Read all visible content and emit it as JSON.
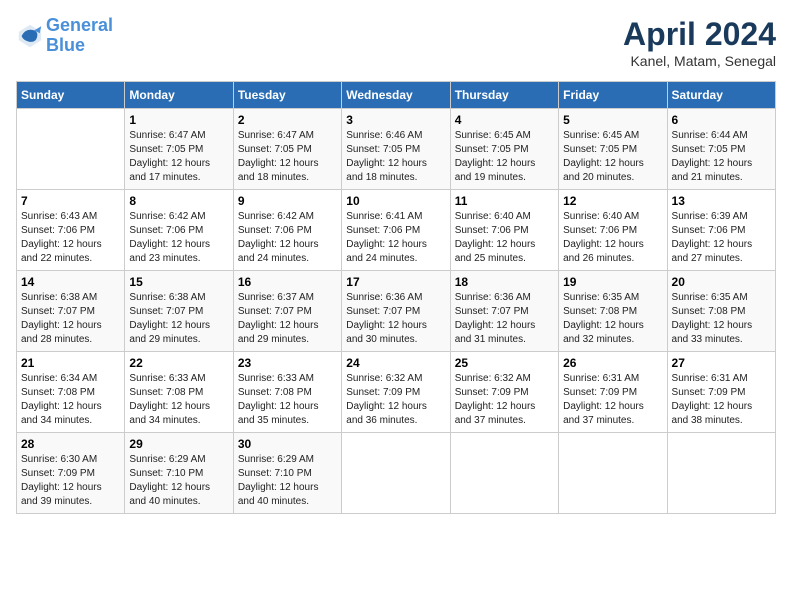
{
  "header": {
    "logo_line1": "General",
    "logo_line2": "Blue",
    "month": "April 2024",
    "location": "Kanel, Matam, Senegal"
  },
  "days_of_week": [
    "Sunday",
    "Monday",
    "Tuesday",
    "Wednesday",
    "Thursday",
    "Friday",
    "Saturday"
  ],
  "weeks": [
    [
      {
        "day": "",
        "info": ""
      },
      {
        "day": "1",
        "info": "Sunrise: 6:47 AM\nSunset: 7:05 PM\nDaylight: 12 hours\nand 17 minutes."
      },
      {
        "day": "2",
        "info": "Sunrise: 6:47 AM\nSunset: 7:05 PM\nDaylight: 12 hours\nand 18 minutes."
      },
      {
        "day": "3",
        "info": "Sunrise: 6:46 AM\nSunset: 7:05 PM\nDaylight: 12 hours\nand 18 minutes."
      },
      {
        "day": "4",
        "info": "Sunrise: 6:45 AM\nSunset: 7:05 PM\nDaylight: 12 hours\nand 19 minutes."
      },
      {
        "day": "5",
        "info": "Sunrise: 6:45 AM\nSunset: 7:05 PM\nDaylight: 12 hours\nand 20 minutes."
      },
      {
        "day": "6",
        "info": "Sunrise: 6:44 AM\nSunset: 7:05 PM\nDaylight: 12 hours\nand 21 minutes."
      }
    ],
    [
      {
        "day": "7",
        "info": "Sunrise: 6:43 AM\nSunset: 7:06 PM\nDaylight: 12 hours\nand 22 minutes."
      },
      {
        "day": "8",
        "info": "Sunrise: 6:42 AM\nSunset: 7:06 PM\nDaylight: 12 hours\nand 23 minutes."
      },
      {
        "day": "9",
        "info": "Sunrise: 6:42 AM\nSunset: 7:06 PM\nDaylight: 12 hours\nand 24 minutes."
      },
      {
        "day": "10",
        "info": "Sunrise: 6:41 AM\nSunset: 7:06 PM\nDaylight: 12 hours\nand 24 minutes."
      },
      {
        "day": "11",
        "info": "Sunrise: 6:40 AM\nSunset: 7:06 PM\nDaylight: 12 hours\nand 25 minutes."
      },
      {
        "day": "12",
        "info": "Sunrise: 6:40 AM\nSunset: 7:06 PM\nDaylight: 12 hours\nand 26 minutes."
      },
      {
        "day": "13",
        "info": "Sunrise: 6:39 AM\nSunset: 7:06 PM\nDaylight: 12 hours\nand 27 minutes."
      }
    ],
    [
      {
        "day": "14",
        "info": "Sunrise: 6:38 AM\nSunset: 7:07 PM\nDaylight: 12 hours\nand 28 minutes."
      },
      {
        "day": "15",
        "info": "Sunrise: 6:38 AM\nSunset: 7:07 PM\nDaylight: 12 hours\nand 29 minutes."
      },
      {
        "day": "16",
        "info": "Sunrise: 6:37 AM\nSunset: 7:07 PM\nDaylight: 12 hours\nand 29 minutes."
      },
      {
        "day": "17",
        "info": "Sunrise: 6:36 AM\nSunset: 7:07 PM\nDaylight: 12 hours\nand 30 minutes."
      },
      {
        "day": "18",
        "info": "Sunrise: 6:36 AM\nSunset: 7:07 PM\nDaylight: 12 hours\nand 31 minutes."
      },
      {
        "day": "19",
        "info": "Sunrise: 6:35 AM\nSunset: 7:08 PM\nDaylight: 12 hours\nand 32 minutes."
      },
      {
        "day": "20",
        "info": "Sunrise: 6:35 AM\nSunset: 7:08 PM\nDaylight: 12 hours\nand 33 minutes."
      }
    ],
    [
      {
        "day": "21",
        "info": "Sunrise: 6:34 AM\nSunset: 7:08 PM\nDaylight: 12 hours\nand 34 minutes."
      },
      {
        "day": "22",
        "info": "Sunrise: 6:33 AM\nSunset: 7:08 PM\nDaylight: 12 hours\nand 34 minutes."
      },
      {
        "day": "23",
        "info": "Sunrise: 6:33 AM\nSunset: 7:08 PM\nDaylight: 12 hours\nand 35 minutes."
      },
      {
        "day": "24",
        "info": "Sunrise: 6:32 AM\nSunset: 7:09 PM\nDaylight: 12 hours\nand 36 minutes."
      },
      {
        "day": "25",
        "info": "Sunrise: 6:32 AM\nSunset: 7:09 PM\nDaylight: 12 hours\nand 37 minutes."
      },
      {
        "day": "26",
        "info": "Sunrise: 6:31 AM\nSunset: 7:09 PM\nDaylight: 12 hours\nand 37 minutes."
      },
      {
        "day": "27",
        "info": "Sunrise: 6:31 AM\nSunset: 7:09 PM\nDaylight: 12 hours\nand 38 minutes."
      }
    ],
    [
      {
        "day": "28",
        "info": "Sunrise: 6:30 AM\nSunset: 7:09 PM\nDaylight: 12 hours\nand 39 minutes."
      },
      {
        "day": "29",
        "info": "Sunrise: 6:29 AM\nSunset: 7:10 PM\nDaylight: 12 hours\nand 40 minutes."
      },
      {
        "day": "30",
        "info": "Sunrise: 6:29 AM\nSunset: 7:10 PM\nDaylight: 12 hours\nand 40 minutes."
      },
      {
        "day": "",
        "info": ""
      },
      {
        "day": "",
        "info": ""
      },
      {
        "day": "",
        "info": ""
      },
      {
        "day": "",
        "info": ""
      }
    ]
  ]
}
